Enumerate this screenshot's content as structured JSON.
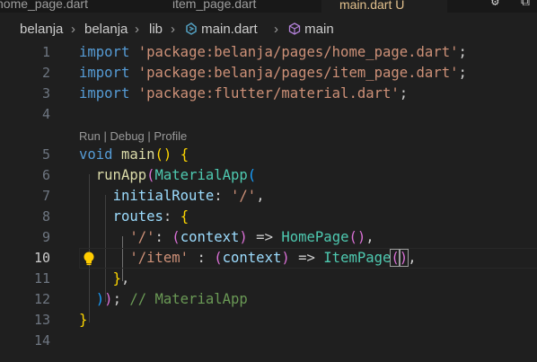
{
  "tabs": [
    {
      "label": "home_page.dart",
      "active": false
    },
    {
      "label": "item_page.dart",
      "active": false
    },
    {
      "label": "main.dart",
      "modified_mark": "U",
      "active": true
    }
  ],
  "breadcrumb": {
    "items": [
      "belanja",
      "belanja",
      "lib",
      "main.dart",
      "main"
    ]
  },
  "codelens": {
    "run": "Run",
    "sep1": " | ",
    "debug": "Debug",
    "sep2": " | ",
    "profile": "Profile"
  },
  "line_numbers": [
    "1",
    "2",
    "3",
    "4",
    "5",
    "6",
    "7",
    "8",
    "9",
    "10",
    "11",
    "12",
    "13",
    "14"
  ],
  "active_line": "10",
  "code": {
    "l1_kw": "import",
    "l1_str": "'package:belanja/pages/home_page.dart'",
    "l1_end": ";",
    "l2_kw": "import",
    "l2_str": "'package:belanja/pages/item_page.dart'",
    "l2_end": ";",
    "l3_kw": "import",
    "l3_str": "'package:flutter/material.dart'",
    "l3_end": ";",
    "l5_kw": "void",
    "l5_fn": "main",
    "l5_p": "()",
    "l5_b": "{",
    "l6_fn": "runApp",
    "l6_p": "(",
    "l6_cls": "MaterialApp",
    "l6_p2": "(",
    "l7_var": "initialRoute",
    "l7_colon": ": ",
    "l7_str": "'/'",
    "l7_end": ",",
    "l8_var": "routes",
    "l8_colon": ": ",
    "l8_b": "{",
    "l9_str": "'/'",
    "l9_colon": ": ",
    "l9_p": "(",
    "l9_var": "context",
    "l9_p2": ")",
    "l9_arrow": " => ",
    "l9_cls": "HomePage",
    "l9_p3": "()",
    "l9_end": ",",
    "l10_str": "'/item'",
    "l10_colon": " : ",
    "l10_p": "(",
    "l10_var": "context",
    "l10_p2": ")",
    "l10_arrow": " => ",
    "l10_cls": "ItemPage",
    "l10_p3a": "(",
    "l10_p3b": ")",
    "l10_end": ",",
    "l11_b": "}",
    "l11_end": ",",
    "l12_p": ")",
    "l12_p2": ")",
    "l12_end": ";",
    "l12_cmt": "// MaterialApp",
    "l13_b": "}"
  },
  "colors": {
    "background": "#1f1f1f",
    "keyword": "#569cd6",
    "string": "#ce9178",
    "function": "#dcdcaa",
    "class": "#4ec9b0",
    "variable": "#9cdcfe",
    "comment": "#6a9955",
    "bracket1": "#ffd700",
    "bracket2": "#da70d6",
    "bracket3": "#179fff"
  },
  "icons": [
    "dart-file-icon",
    "symbol-method-icon",
    "chevron-right-icon",
    "lightbulb-icon",
    "settings-icon"
  ]
}
